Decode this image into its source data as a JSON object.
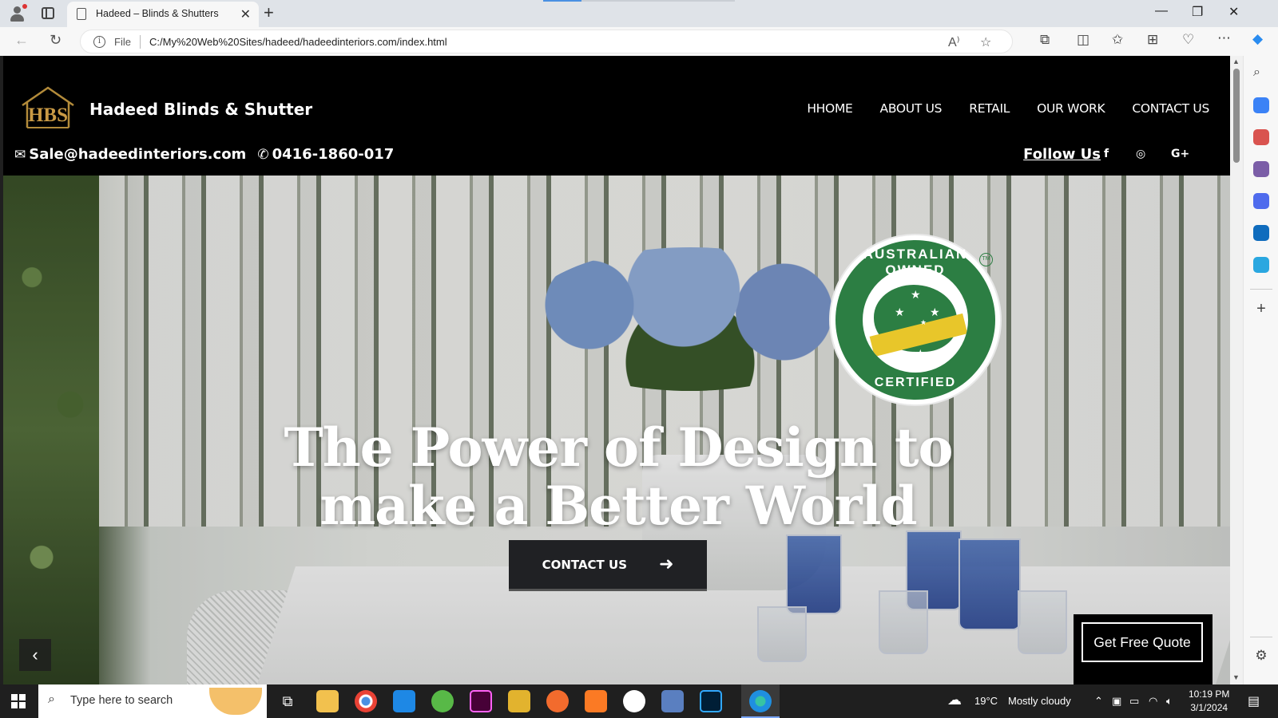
{
  "browser": {
    "tab_title": "Hadeed – Blinds & Shutters",
    "url_scheme": "File",
    "url": "C:/My%20Web%20Sites/hadeed/hadeedinteriors.com/index.html"
  },
  "site": {
    "brand": "Hadeed Blinds & Shutter",
    "logo_text": "HBS",
    "nav": [
      "HHOME",
      "ABOUT US",
      "RETAIL",
      "OUR WORK",
      "CONTACT US"
    ],
    "email": "Sale@hadeedinteriors.com",
    "phone": "0416-1860-017",
    "follow_label": "Follow Us",
    "social": {
      "facebook": "f",
      "instagram": "◎",
      "google_plus": "G+"
    }
  },
  "hero": {
    "headline_line1": "The Power of Design to",
    "headline_line2": "make a Better World",
    "cta_label": "CONTACT US",
    "badge_top": "AUSTRALIAN OWNED",
    "badge_bottom": "CERTIFIED",
    "badge_tm": "TM",
    "quote_label": "Get Free Quote"
  },
  "taskbar": {
    "search_placeholder": "Type here to search",
    "temperature": "19°C",
    "weather": "Mostly cloudy",
    "time": "10:19 PM",
    "date": "3/1/2024"
  },
  "colors": {
    "badge_green": "#2c7e43",
    "badge_gold": "#e8c62a",
    "header_bg": "#000000",
    "cta_bg": "#202124"
  },
  "icons": {
    "email": "envelope-icon",
    "phone": "phone-icon",
    "prev": "chevron-left-icon",
    "next": "chevron-right-icon",
    "cta": "arrow-right-icon"
  }
}
